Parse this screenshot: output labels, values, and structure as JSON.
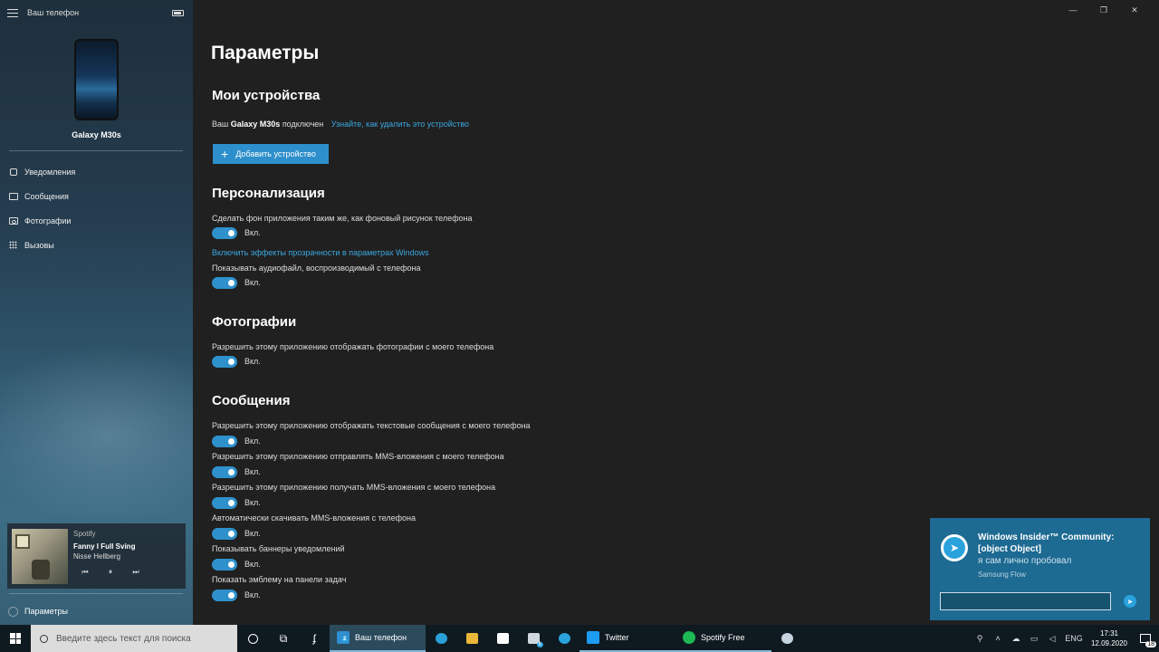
{
  "sidebar": {
    "app_title": "Ваш телефон",
    "device_name": "Galaxy M30s",
    "nav": [
      {
        "label": "Уведомления"
      },
      {
        "label": "Сообщения"
      },
      {
        "label": "Фотографии"
      },
      {
        "label": "Вызовы"
      }
    ],
    "player": {
      "source": "Spotify",
      "song": "Fanny I Full Sving",
      "artist": "Nisse Hellberg"
    },
    "settings_label": "Параметры"
  },
  "window_controls": {
    "minimize": "—",
    "restore": "❐",
    "close": "✕"
  },
  "main": {
    "title": "Параметры",
    "devices": {
      "heading": "Мои устройства",
      "connected_prefix": "Ваш",
      "connected_device": "Galaxy M30s",
      "connected_suffix": "подключен",
      "remove_link": "Узнайте, как удалить это устройство",
      "add_button": "Добавить устройство"
    },
    "personalization": {
      "heading": "Персонализация",
      "wallpaper_label": "Сделать фон приложения таким же, как фоновый рисунок телефона",
      "transparency_link": "Включить эффекты прозрачности в параметрах Windows",
      "audio_label": "Показывать аудиофайл, воспроизводимый с телефона"
    },
    "photos": {
      "heading": "Фотографии",
      "allow_label": "Разрешить этому приложению отображать фотографии с моего телефона"
    },
    "messages": {
      "heading": "Сообщения",
      "items": [
        {
          "label": "Разрешить этому приложению отображать текстовые сообщения с моего телефона"
        },
        {
          "label": "Разрешить этому приложению отправлять MMS-вложения с моего телефона"
        },
        {
          "label": "Разрешить этому приложению получать MMS-вложения с моего телефона"
        },
        {
          "label": "Автоматически скачивать MMS-вложения с телефона"
        },
        {
          "label": "Показывать баннеры уведомлений"
        },
        {
          "label": "Показать эмблему на панели задач"
        }
      ]
    },
    "toggle_state": "Вкл."
  },
  "toast": {
    "title": "Windows Insider™ Community: [object Object]",
    "message": "я сам лично пробовал",
    "app": "Samsung Flow",
    "reply_value": ""
  },
  "taskbar": {
    "search_placeholder": "Введите здесь текст для поиска",
    "active_app": "Ваш телефон",
    "active_badge": "2",
    "mail_badge": "6",
    "twitter": "Twitter",
    "spotify": "Spotify Free",
    "lang": "ENG",
    "time": "17:31",
    "date": "12.09.2020",
    "notif_count": "18"
  },
  "colors": {
    "accent": "#2e91cc",
    "link": "#3aa7e0",
    "toast_bg": "#1d6a92",
    "main_bg": "#202020"
  }
}
